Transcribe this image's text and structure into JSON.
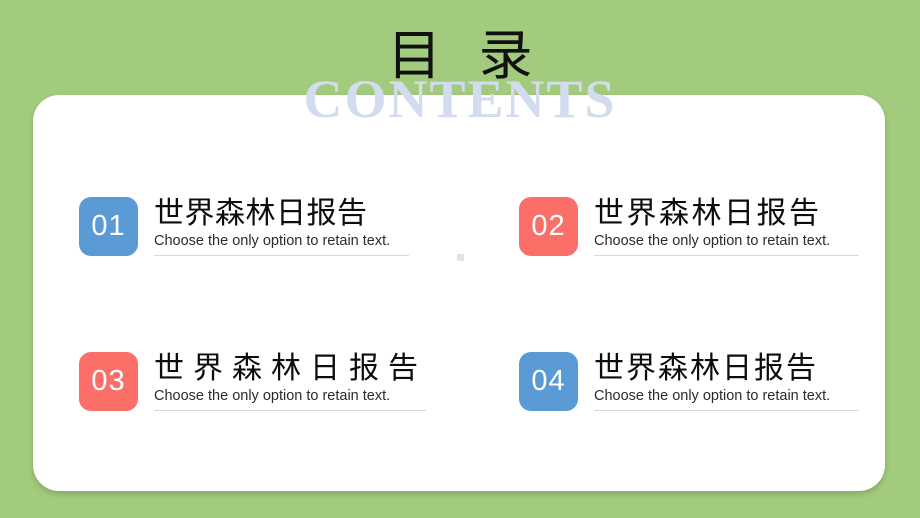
{
  "slide": {
    "background_color": "#a3cb7e",
    "card_color": "#ffffff"
  },
  "header": {
    "title_cn": "目 录",
    "title_en": "CONTENTS",
    "title_color": "#111111",
    "ghost_color": "#d3dbee"
  },
  "colors": {
    "blue": "#5b9bd5",
    "red": "#fb6f68",
    "rule": "#d8d8d8",
    "dot": "#e2e2e2"
  },
  "entries": [
    {
      "number": "01",
      "title": "世界森林日报告",
      "subtitle": "Choose the only option to retain text.",
      "badge_color": "#5b9bd5"
    },
    {
      "number": "02",
      "title": "世界森林日报告",
      "subtitle": "Choose the only option to retain text.",
      "badge_color": "#fb6f68"
    },
    {
      "number": "03",
      "title": "世界森林日报告",
      "subtitle": "Choose the only option to retain text.",
      "badge_color": "#fb6f68"
    },
    {
      "number": "04",
      "title": "世界森林日报告",
      "subtitle": "Choose the only option to retain text.",
      "badge_color": "#5b9bd5"
    }
  ]
}
